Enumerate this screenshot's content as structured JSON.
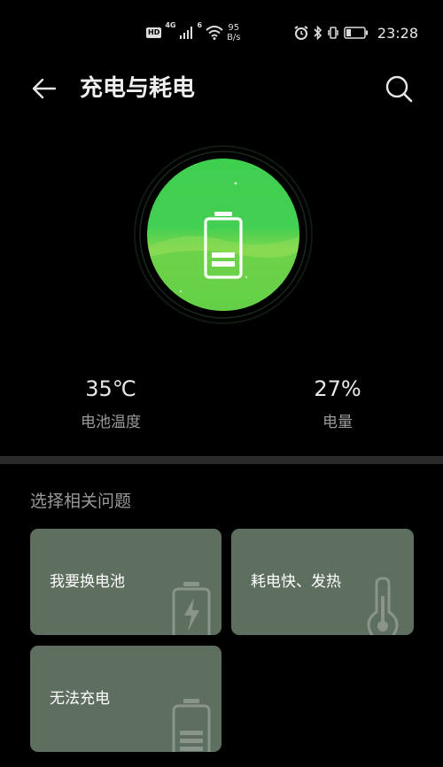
{
  "status_bar": {
    "hd": "HD",
    "net": "4G",
    "wifi_badge": "6",
    "speed_value": "95",
    "speed_unit": "B/s",
    "time": "23:28"
  },
  "header": {
    "title": "充电与耗电"
  },
  "battery": {
    "temperature_value": "35℃",
    "temperature_label": "电池温度",
    "level_value": "27%",
    "level_label": "电量",
    "level_fraction": 0.27,
    "accent_color": "#43cf52"
  },
  "issues": {
    "section_title": "选择相关问题",
    "cards": [
      {
        "label": "我要换电池",
        "icon": "battery-charging-icon"
      },
      {
        "label": "耗电快、发热",
        "icon": "thermometer-icon"
      },
      {
        "label": "无法充电",
        "icon": "battery-icon"
      }
    ],
    "card_color": "#5f6f5f"
  }
}
